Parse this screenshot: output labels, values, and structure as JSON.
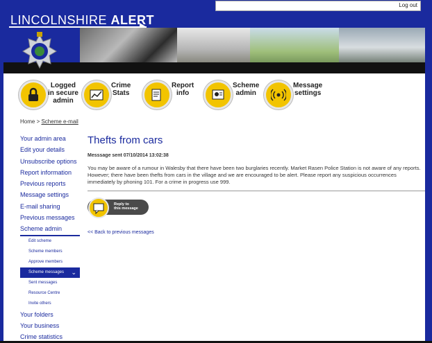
{
  "topbar": {
    "logout_label": "Log out"
  },
  "header": {
    "brand_plain": "LINCOLNSHIRE ",
    "brand_bold": "ALERT"
  },
  "icons": [
    {
      "label": "Logged\nin secure\nadmin",
      "icon": "padlock-icon"
    },
    {
      "label": "Crime\nStats",
      "icon": "stats-icon"
    },
    {
      "label": "Report\ninfo",
      "icon": "report-icon"
    },
    {
      "label": "Scheme\nadmin",
      "icon": "admin-icon"
    },
    {
      "label": "Message\nsettings",
      "icon": "broadcast-icon"
    }
  ],
  "breadcrumb": {
    "home": "Home",
    "sep": " > ",
    "current": "Scheme e-mail"
  },
  "sidebar": {
    "items": [
      "Your admin area",
      "Edit your details",
      "Unsubscribe options",
      "Report information",
      "Previous reports",
      "Message settings",
      "E-mail sharing",
      "Previous messages"
    ],
    "active": "Scheme admin",
    "sub": [
      "Edit scheme",
      "Scheme members",
      "Approve members"
    ],
    "sub_selected": "Scheme messages",
    "sub_after": [
      "Sent messages",
      "Resource Centre",
      "Invite others"
    ],
    "after": [
      "Your folders",
      "Your business",
      "Crime statistics"
    ]
  },
  "main": {
    "title": "Thefts from cars",
    "sent": "Messsage sent 07/10/2014 13:02:38",
    "body": "You may be aware of a rumour in Walesby that there have been two burglaries recently. Market Rasen Police Station is not aware of any reports. However; there have been thefts from cars in the village and we are encouraged to be alert. Please report any suspicious occurrences immediately by phoning 101. For a crime in progress use 999.",
    "reply_label": "Reply to\nthis message",
    "back_link": "<< Back to previous messages"
  }
}
